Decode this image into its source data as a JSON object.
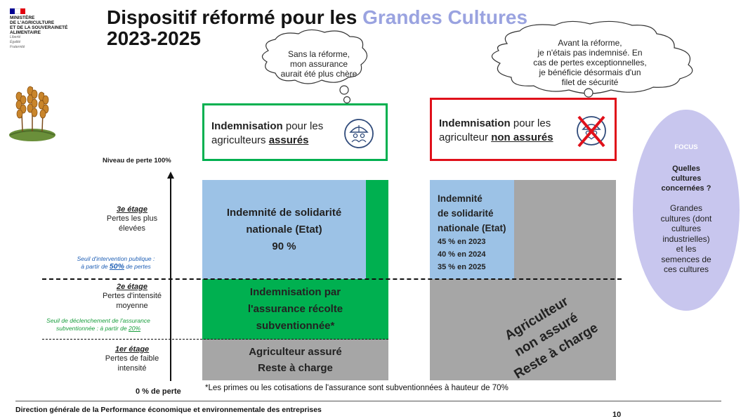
{
  "header": {
    "ministry_lines": [
      "MINISTÈRE",
      "DE L'AGRICULTURE",
      "ET DE LA SOUVERAINETÉ",
      "ALIMENTAIRE"
    ],
    "motto_lines": [
      "Liberté",
      "Égalité",
      "Fraternité"
    ],
    "title_part1": "Dispositif réformé pour les ",
    "title_accent": "Grandes Cultures",
    "title_line2": "2023-2025"
  },
  "bubbles": {
    "left": [
      "Sans la réforme,",
      "mon assurance",
      "aurait été plus chère"
    ],
    "right": [
      "Avant la réforme,",
      "je n'étais pas indemnisé. En",
      "cas de pertes exceptionnelles,",
      "je bénéficie désormais d'un",
      "filet de sécurité"
    ]
  },
  "cards": {
    "insured": {
      "bold": "Indemnisation",
      "rest": " pour les",
      "line2_pre": "agriculteurs ",
      "line2_u": "assurés"
    },
    "uninsured": {
      "bold": "Indemnisation",
      "rest": " pour les",
      "line2_pre": "agriculteur ",
      "line2_u": "non assurés"
    }
  },
  "axis": {
    "top_label": "Niveau de perte 100%",
    "bottom_label": "0 % de perte"
  },
  "levels": [
    {
      "title": "3e étage",
      "desc": [
        "Pertes les plus",
        "élevées"
      ]
    },
    {
      "title": "2e étage",
      "desc": [
        "Pertes d'intensité",
        "moyenne"
      ]
    },
    {
      "title": "1er étage",
      "desc": [
        "Pertes de faible",
        "intensité"
      ]
    }
  ],
  "thresholds": {
    "public": {
      "line1": "Seuil d'intervention publique :",
      "line2_pre": "à partir de ",
      "value": "50%",
      "line2_post": " de pertes"
    },
    "insurance": {
      "line1": "Seuil de déclenchement de l'assurance",
      "line2_pre": "subventionnée : à partir de ",
      "value": "20%"
    }
  },
  "insured_blocks": {
    "solidarity": [
      "Indemnité de solidarité",
      "nationale (Etat)",
      "90 %"
    ],
    "insurance": [
      "Indemnisation par",
      "l'assurance récolte",
      "subventionnée*"
    ],
    "self": [
      "Agriculteur assuré",
      "Reste à charge"
    ]
  },
  "uninsured_blocks": {
    "solidarity": [
      "Indemnité",
      "de solidarité",
      "nationale (Etat)"
    ],
    "rates": [
      "45 % en 2023",
      "40 % en 2024",
      "35 % en 2025"
    ],
    "rest": [
      "Agriculteur",
      "non assuré",
      "Reste à charge"
    ]
  },
  "footnote": "*Les primes ou les cotisations de l'assurance sont subventionnées à hauteur de 70%",
  "focus": {
    "title": "FOCUS",
    "question": [
      "Quelles",
      "cultures",
      "concernées ?"
    ],
    "answer": [
      "Grandes",
      "cultures (dont",
      "cultures",
      "industrielles)",
      "et les",
      "semences de",
      "ces cultures"
    ]
  },
  "footer": {
    "text": "Direction générale de la Performance économique et environnementale des entreprises",
    "page": "10"
  },
  "colors": {
    "blue": "#9cc2e6",
    "green": "#00b050",
    "grey": "#a6a6a6",
    "red": "#e0101a",
    "focus": "#c8c6ee",
    "accent": "#9aa3e0"
  },
  "icons": [
    "wheat-icon",
    "umbrella-people-icon",
    "crossed-umbrella-icon"
  ]
}
